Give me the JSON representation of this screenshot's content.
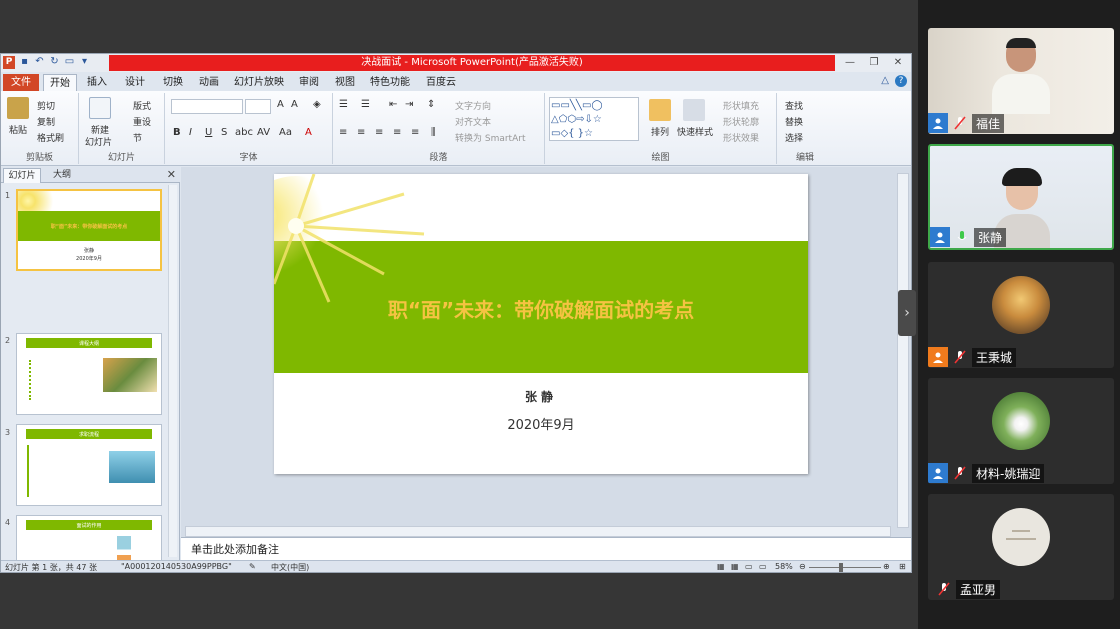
{
  "ppt": {
    "title": "决战面试 - Microsoft PowerPoint(产品激活失败)",
    "tabs": [
      "文件",
      "开始",
      "插入",
      "设计",
      "切换",
      "动画",
      "幻灯片放映",
      "审阅",
      "视图",
      "特色功能",
      "百度云"
    ],
    "ribbon": {
      "clipboard": {
        "paste": "粘贴",
        "cut": "剪切",
        "copy": "复制",
        "format_painter": "格式刷",
        "name": "剪贴板"
      },
      "slides": {
        "new_slide": "新建",
        "new_slide2": "幻灯片",
        "layout": "版式",
        "reset": "重设",
        "section": "节",
        "name": "幻灯片"
      },
      "font": {
        "name": "字体"
      },
      "paragraph": {
        "text_direction": "文字方向",
        "align_text": "对齐文本",
        "smartart": "转换为 SmartArt",
        "name": "段落"
      },
      "drawing": {
        "arrange": "排列",
        "quick_styles": "快速样式",
        "shape_fill": "形状填充",
        "shape_outline": "形状轮廓",
        "shape_effects": "形状效果",
        "name": "绘图"
      },
      "editing": {
        "find": "查找",
        "replace": "替换",
        "select": "选择",
        "name": "编辑"
      }
    },
    "panel_tabs": {
      "slides": "幻灯片",
      "outline": "大纲"
    },
    "thumb_numbers": [
      "1",
      "2",
      "3",
      "4"
    ],
    "thumbs": [
      {
        "title": "职“面”未来：带你破解面试的考点",
        "author": "张静",
        "date": "2020年9月"
      },
      {
        "title": "课程大纲"
      },
      {
        "title": "求职流程"
      },
      {
        "title": "面试的作用"
      }
    ],
    "slide": {
      "title": "职“面”未来：带你破解面试的考点",
      "author": "张静",
      "date": "2020年9月"
    },
    "notes_placeholder": "单击此处添加备注",
    "status": {
      "slide_info": "幻灯片 第 1 张，共 47 张",
      "theme": "\"A000120140530A99PPBG\"",
      "language": "中文(中国)",
      "zoom": "58%"
    }
  },
  "participants": [
    {
      "name": "福佳",
      "icon": "user-icon",
      "mic": "muted"
    },
    {
      "name": "张静",
      "icon": "user-icon",
      "mic": "active"
    },
    {
      "name": "王秉城",
      "icon": "user-icon-orange",
      "mic": "muted"
    },
    {
      "name": "材料-姚瑞迎",
      "icon": "user-icon",
      "mic": "muted"
    },
    {
      "name": "孟亚男",
      "icon": "none",
      "mic": "muted"
    }
  ],
  "colors": {
    "slide_band": "#7fb800",
    "slide_title": "#f5c342",
    "ppt_red": "#d24726",
    "active_border": "#3fa84a"
  }
}
